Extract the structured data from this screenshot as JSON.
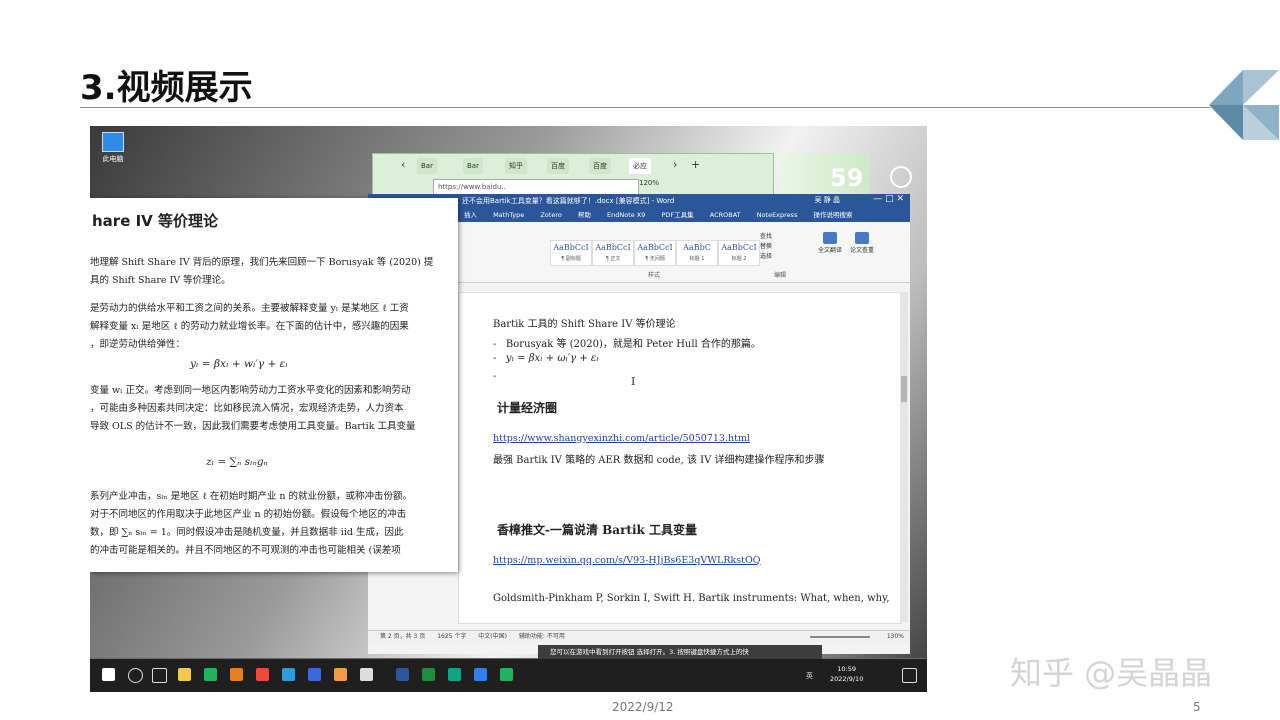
{
  "slide": {
    "title": "3.视频展示",
    "date": "2022/9/12",
    "page_number": "5",
    "watermark": "知乎 @吴晶晶"
  },
  "desktop": {
    "icon_label": "此电脑"
  },
  "browser": {
    "tabs": [
      "Bar",
      "Bar",
      "知乎",
      "百度",
      "百度",
      "必应"
    ],
    "url": "https://www.baidu..",
    "zoom": "120%",
    "clock": "59"
  },
  "word": {
    "title": "还不会用Bartik工具变量？看这篇就够了！.docx [兼容模式] - Word",
    "user": "吴 静 晶",
    "window_controls": "—  □  ✕",
    "ribbon_tabs": [
      "插入",
      "MathType",
      "Zotero",
      "帮助",
      "EndNote X9",
      "PDF工具集",
      "ACROBAT",
      "NoteExpress",
      "操作说明搜索"
    ],
    "styles": [
      {
        "sample": "AaBbCcI",
        "name": "¶ 副标题"
      },
      {
        "sample": "AaBbCcI",
        "name": "¶ 正文"
      },
      {
        "sample": "AaBbCcI",
        "name": "¶ 无间隔"
      },
      {
        "sample": "AaBbC",
        "name": "标题 1"
      },
      {
        "sample": "AaBbCcI",
        "name": "标题 2"
      }
    ],
    "group_style": "样式",
    "group_edit": "编辑",
    "edit_commands": [
      "查找",
      "替换",
      "选择"
    ],
    "buttons": [
      "全文翻译",
      "论文查重"
    ],
    "doc": {
      "heading": "Bartik 工具的 Shift Share IV 等价理论",
      "bullet1": "Borusyak 等 (2020)，就是和 Peter Hull 合作的那篇。",
      "bullet2": "yₗ = βxₗ + ωₗ′γ + εₗ",
      "bullet3": "",
      "section1": "计量经济圈",
      "link1": "https://www.shangyexinzhi.com/article/5050713.html",
      "desc1": "最强 Bartik IV 策略的 AER 数据和 code, 该 IV 详细构建操作程序和步骤",
      "section2": "香樟推文-一篇说清 Bartik 工具变量",
      "link2": "https://mp.weixin.qq.com/s/V93-HJjBs6E3qVWLRkstOQ",
      "ref": "Goldsmith-Pinkham P, Sorkin I, Swift H. Bartik instruments: What, when, why,"
    },
    "status": {
      "page": "第 2 页，共 3 页",
      "words": "1625 个字",
      "lang": "中文(中国)",
      "accessibility": "辅助功能: 不可用",
      "zoom": "130%"
    }
  },
  "pdf": {
    "heading": "hare IV 等价理论",
    "lines": [
      "地理解 Shift Share IV 背后的原理，我们先来回顾一下 Borusyak 等 (2020) 提",
      "具的 Shift Share IV 等价理论。",
      "是劳动力的供给水平和工资之间的关系。主要被解释变量 yₗ 是某地区 ℓ 工资",
      "解释变量 xₗ 是地区 ℓ 的劳动力就业增长率。在下面的估计中，感兴趣的因果",
      "，即逆劳动供给弹性：",
      "变量 wₗ 正交。考虑到同一地区内影响劳动力工资水平变化的因素和影响劳动",
      "，可能由多种因素共同决定：比如移民流入情况，宏观经济走势，人力资本",
      "导致 OLS 的估计不一致，因此我们需要考虑使用工具变量。Bartik 工具变量",
      "系列产业冲击，sₗₙ 是地区 ℓ 在初始时期产业 n 的就业份额，或称冲击份额。",
      "对于不同地区的作用取决于此地区产业 n 的初始份额。假设每个地区的冲击",
      "数，即 ∑ₙ sₗₙ = 1。同时假设冲击是随机变量，并且数据非 iid 生成，因此",
      "的冲击可能是相关的。并且不同地区的不可观测的冲击也可能相关 (误差项"
    ],
    "eq1": "yₗ = βxₗ + wₗ′γ + εₗ",
    "eq2": "zₗ = ∑ₙ sₗₙgₙ"
  },
  "notification": "您可以在游戏中看到打开按钮 选择打开。3. 按照键盘快捷方式上的快",
  "taskbar": {
    "time": "10:59",
    "date": "2022/9/10",
    "tray_lang": "英"
  }
}
